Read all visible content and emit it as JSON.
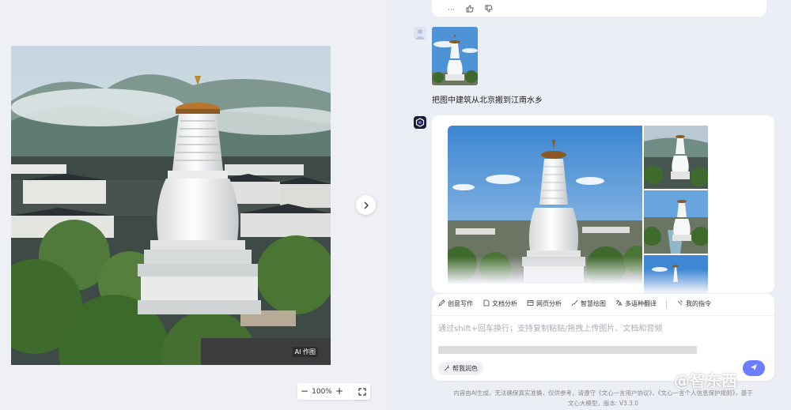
{
  "preview": {
    "ai_badge": "AI 作图",
    "zoom": {
      "minus": "−",
      "value": "100%",
      "plus": "+"
    }
  },
  "chat": {
    "prev_actions": {
      "more": "···"
    },
    "user_message": {
      "text": "把图中建筑从北京搬到江南水乡"
    }
  },
  "input": {
    "tools": [
      {
        "icon": "edit-icon",
        "label": "创意写作"
      },
      {
        "icon": "doc-icon",
        "label": "文档分析"
      },
      {
        "icon": "web-icon",
        "label": "网页分析"
      },
      {
        "icon": "paint-icon",
        "label": "智慧绘图"
      },
      {
        "icon": "translate-icon",
        "label": "多语种翻译"
      },
      {
        "icon": "command-icon",
        "label": "我的指令"
      }
    ],
    "placeholder": "通过shift+回车换行；支持复制粘贴/拖拽上传图片、文档和音频",
    "polish_label": "帮我润色"
  },
  "footer": {
    "line1": "内容由AI生成，无法确保真实准确，仅供参考，请遵守《文心一言用户协议》、《文心一言个人信息保护规则》，基于",
    "line2": "文心大模型，版本: V3.3.0"
  },
  "watermark": "@智东西",
  "colors": {
    "accent": "#6d7dff",
    "background": "#eceef5",
    "card": "#ffffff"
  }
}
